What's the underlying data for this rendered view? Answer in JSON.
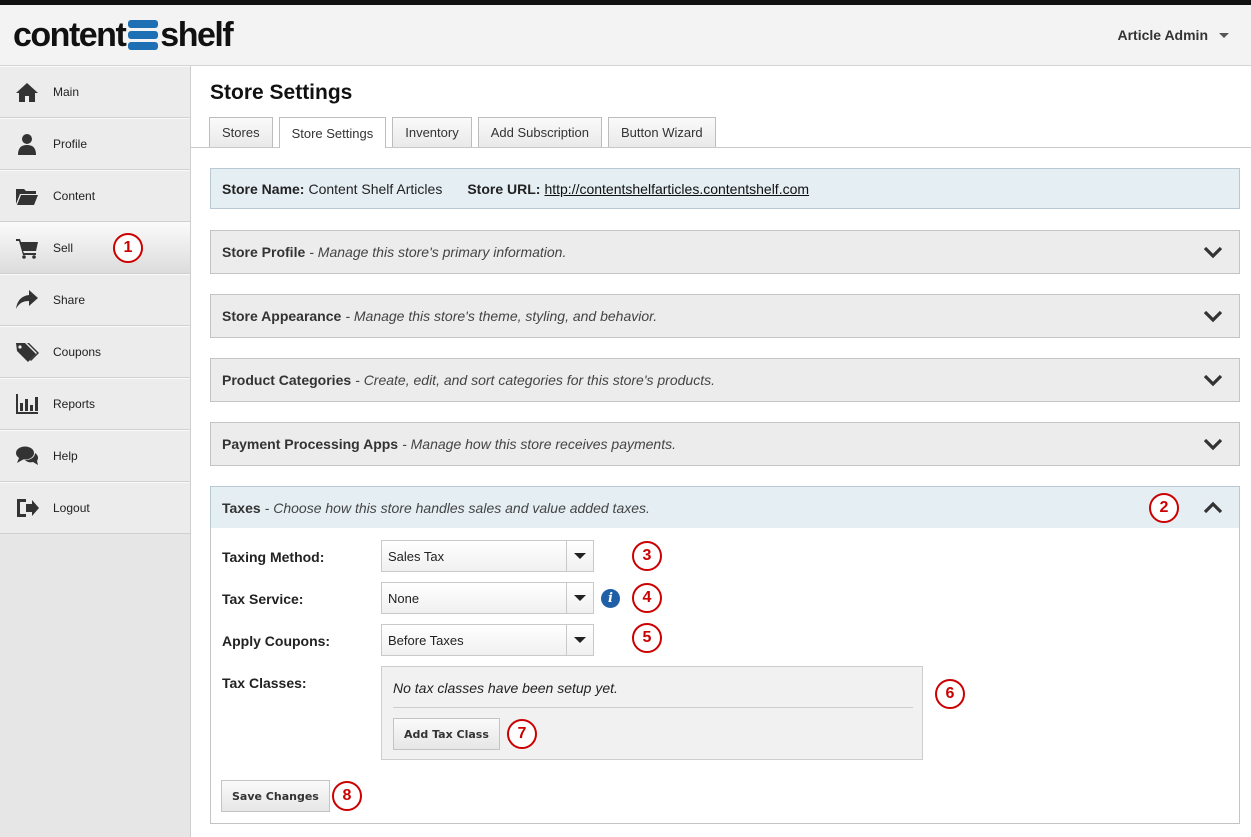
{
  "header": {
    "logo_text_left": "content",
    "logo_text_right": "shelf",
    "user_label": "Article Admin"
  },
  "sidebar": {
    "items": [
      {
        "label": "Main",
        "icon": "home-icon"
      },
      {
        "label": "Profile",
        "icon": "user-icon"
      },
      {
        "label": "Content",
        "icon": "folder-icon"
      },
      {
        "label": "Sell",
        "icon": "cart-icon"
      },
      {
        "label": "Share",
        "icon": "share-icon"
      },
      {
        "label": "Coupons",
        "icon": "tags-icon"
      },
      {
        "label": "Reports",
        "icon": "bar-chart-icon"
      },
      {
        "label": "Help",
        "icon": "chat-icon"
      },
      {
        "label": "Logout",
        "icon": "logout-icon"
      }
    ],
    "active": "Sell"
  },
  "page": {
    "title": "Store Settings",
    "tabs": [
      {
        "label": "Stores"
      },
      {
        "label": "Store Settings"
      },
      {
        "label": "Inventory"
      },
      {
        "label": "Add Subscription"
      },
      {
        "label": "Button Wizard"
      }
    ],
    "active_tab": "Store Settings"
  },
  "store_info": {
    "name_label": "Store Name:",
    "name_value": "Content Shelf Articles",
    "url_label": "Store URL:",
    "url_value": "http://contentshelfarticles.contentshelf.com"
  },
  "panels": [
    {
      "title": "Store Profile",
      "desc": "- Manage this store's primary information."
    },
    {
      "title": "Store Appearance",
      "desc": "- Manage this store's theme, styling, and behavior."
    },
    {
      "title": "Product Categories",
      "desc": "- Create, edit, and sort categories for this store's products."
    },
    {
      "title": "Payment Processing Apps",
      "desc": "- Manage how this store receives payments."
    },
    {
      "title": "Taxes",
      "desc": "- Choose how this store handles sales and value added taxes."
    }
  ],
  "taxes": {
    "taxing_method_label": "Taxing Method:",
    "taxing_method_value": "Sales Tax",
    "tax_service_label": "Tax Service:",
    "tax_service_value": "None",
    "apply_coupons_label": "Apply Coupons:",
    "apply_coupons_value": "Before Taxes",
    "tax_classes_label": "Tax Classes:",
    "tax_classes_empty": "No tax classes have been setup yet.",
    "add_tax_class_label": "Add Tax Class",
    "save_label": "Save Changes"
  },
  "callouts": [
    "1",
    "2",
    "3",
    "4",
    "5",
    "6",
    "7",
    "8"
  ],
  "colors": {
    "accent_blue": "#1f6fb5",
    "callout_red": "#cc0000",
    "open_panel_bg": "#e5eef3"
  }
}
